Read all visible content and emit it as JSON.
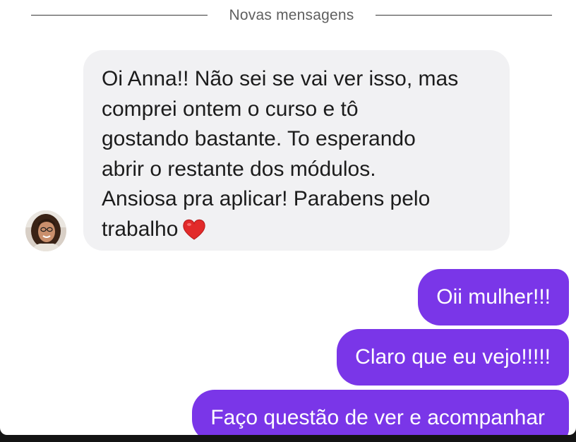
{
  "divider": {
    "label": "Novas mensagens"
  },
  "incoming_message": {
    "sender_avatar": "avatar-woman",
    "lines": [
      "Oi Anna!! Não sei se vai ver isso, mas",
      "comprei ontem o curso e tô",
      "gostando bastante. To esperando",
      "abrir o restante dos módulos.",
      "Ansiosa pra aplicar! Parabens pelo",
      "trabalho"
    ],
    "emoji": "heart-icon",
    "bubble_color": "#f1f1f3"
  },
  "outgoing_messages": [
    {
      "text": "Oii mulher!!!"
    },
    {
      "text": "Claro que eu vejo!!!!!"
    },
    {
      "text": "Faço questão de ver e acompanhar"
    }
  ],
  "colors": {
    "outgoing_bubble": "#7a36e8",
    "outgoing_text": "#ffffff",
    "incoming_text": "#1c1c1c",
    "background": "#ffffff"
  }
}
